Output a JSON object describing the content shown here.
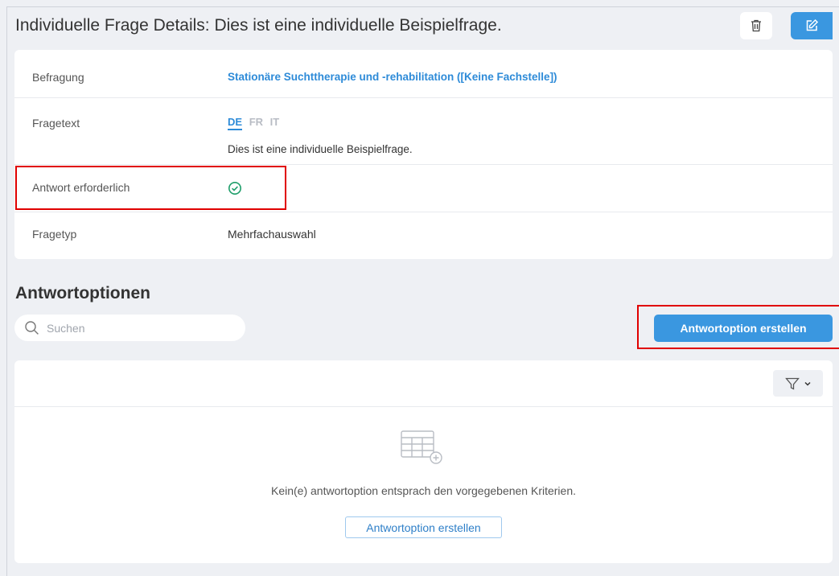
{
  "header": {
    "title": "Individuelle Frage Details: Dies ist eine individuelle Beispielfrage.",
    "delete_icon": "trash-icon",
    "edit_icon": "edit-icon"
  },
  "details": {
    "rows": [
      {
        "label": "Befragung",
        "value": "Stationäre Suchttherapie und -rehabilitation ([Keine Fachstelle])"
      },
      {
        "label": "Fragetext",
        "languages": [
          "DE",
          "FR",
          "IT"
        ],
        "active_language": "DE",
        "value": "Dies ist eine individuelle Beispielfrage."
      },
      {
        "label": "Antwort erforderlich",
        "icon": "check-circle-icon"
      },
      {
        "label": "Fragetyp",
        "value": "Mehrfachauswahl"
      }
    ]
  },
  "answers": {
    "title": "Antwortoptionen",
    "search_placeholder": "Suchen",
    "create_button": "Antwortoption erstellen",
    "empty_text": "Kein(e) antwortoption entsprach den vorgegebenen Kriterien.",
    "empty_create_button": "Antwortoption erstellen"
  },
  "colors": {
    "primary": "#3a97e0",
    "link": "#2e8bd8",
    "success": "#1e9e6a",
    "highlight": "#e00000",
    "background": "#eef0f4"
  }
}
